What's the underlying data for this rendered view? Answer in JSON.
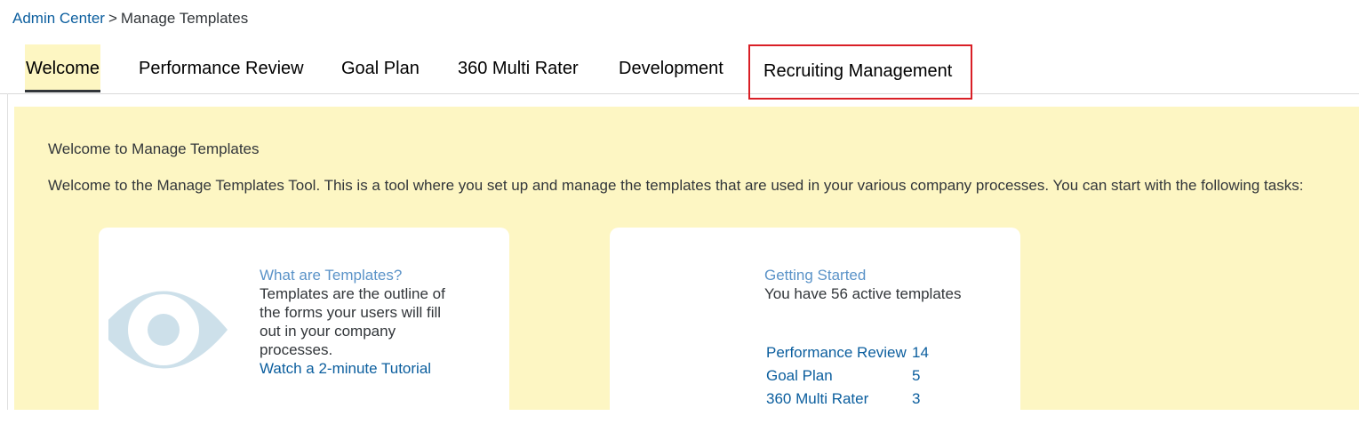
{
  "breadcrumb": {
    "parent": "Admin Center",
    "separator": ">",
    "current": "Manage Templates"
  },
  "tabs": [
    {
      "label": "Welcome",
      "state": "active"
    },
    {
      "label": "Performance Review"
    },
    {
      "label": "Goal Plan"
    },
    {
      "label": "360 Multi Rater"
    },
    {
      "label": "Development"
    },
    {
      "label": "Recruiting Management",
      "state": "highlighted"
    }
  ],
  "welcome": {
    "title": "Welcome to Manage Templates",
    "description": "Welcome to the Manage Templates Tool. This is a tool where you set up and manage the templates that are used in your various company processes. You can start with the following tasks:"
  },
  "card_templates": {
    "icon": "eye-icon",
    "heading": "What are Templates?",
    "body": "Templates are the outline of the forms your users will fill out in your company processes.",
    "action": "Watch a 2-minute Tutorial"
  },
  "card_getting_started": {
    "heading": "Getting Started",
    "summary": "You have 56 active templates",
    "rows": [
      {
        "name": "Performance Review",
        "count": "14"
      },
      {
        "name": "Goal Plan",
        "count": "5"
      },
      {
        "name": "360 Multi Rater",
        "count": "3"
      }
    ]
  },
  "colors": {
    "panel_background": "#fdf6c3",
    "link": "#0b5e9e",
    "light_link": "#5b93c8",
    "highlight_border": "#d91f26",
    "eye_icon": "#cde0ea"
  }
}
